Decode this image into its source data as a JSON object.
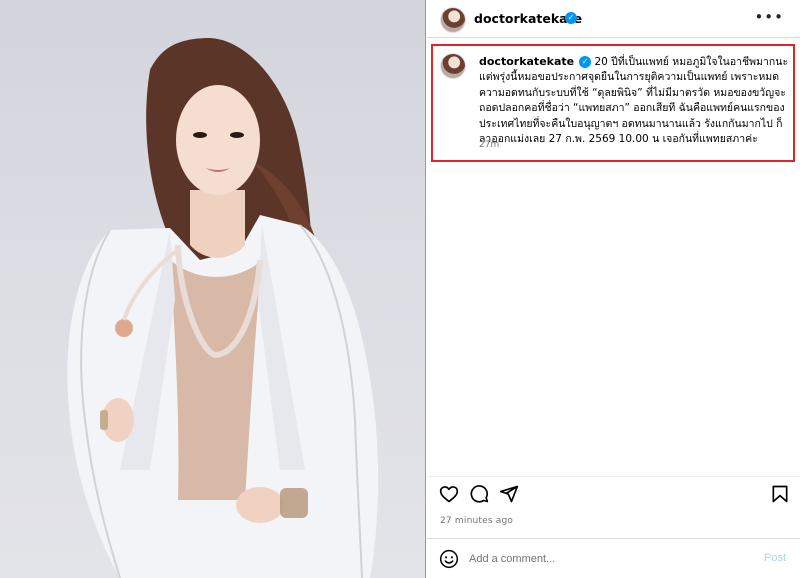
{
  "photo": {
    "alt_subject": "doctor-portrait",
    "background_color": "#d9dae1"
  },
  "post": {
    "username": "doctorkatekate",
    "verified": true,
    "more_icon": "more-horizontal-icon",
    "caption": {
      "text": "20 ปีที่เป็นแพทย์ หมอภูมิใจในอาชีพมากนะ แต่พรุ่งนี้หมอขอประกาศจุดยืนในการยุติความเป็นแพทย์ เพราะหมดความอดทนกับระบบที่ใช้ “ดุลยพินิจ” ที่ไม่มีมาตรวัด หมอของขวัญจะถอดปลอกคอที่ชื่อว่า “แพทยสภา” ออกเสียที ฉันคือแพทย์คนแรกของประเทศไทยที่จะคืนใบอนุญาตฯ อดทนมานานแล้ว รังแกกันมากไป ก็ลาออกแม่งเลย 27 ก.พ. 2569 10.00 น เจอกันที่แพทยสภาค่ะ",
      "time": "27m"
    },
    "highlight_color": "#e0242a",
    "actions": {
      "like_icon": "heart-icon",
      "comment_icon": "comment-icon",
      "share_icon": "share-icon",
      "save_icon": "bookmark-icon"
    },
    "timestamp": "27 minutes ago",
    "comment_box": {
      "emoji_icon": "emoji-icon",
      "placeholder": "Add a comment...",
      "post_label": "Post"
    }
  },
  "colors": {
    "accent": "#0095f6",
    "post_button_disabled": "#a7d3fb",
    "muted_text": "#737373"
  }
}
